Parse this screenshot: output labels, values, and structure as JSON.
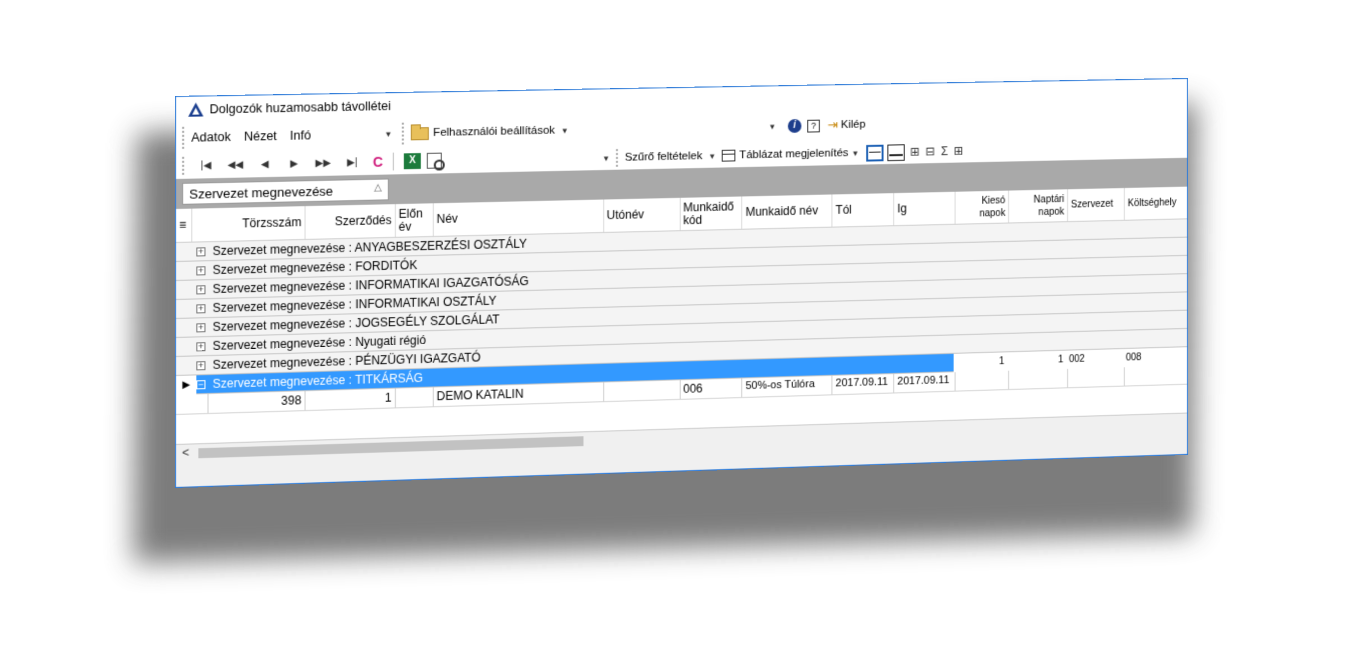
{
  "window": {
    "title": "Dolgozók huzamosabb távollétei",
    "btn_minimize": "—",
    "btn_maximize": "☐",
    "btn_close": "✕"
  },
  "menu": {
    "items": [
      "Adatok",
      "Nézet",
      "Infó"
    ],
    "user_settings": "Felhasználói beállítások",
    "info_glyph": "i",
    "help_glyph": "?",
    "exit": "Kilép"
  },
  "toolbar": {
    "nav": [
      "|◀",
      "◀◀",
      "◀",
      "▶",
      "▶▶",
      "▶|"
    ],
    "refresh": "C",
    "excel": "X",
    "filter": "Szűrő feltételek",
    "table_view": "Táblázat megjelenítés",
    "sum_glyph": "Σ"
  },
  "group_panel": {
    "chip": "Szervezet megnevezése"
  },
  "grid": {
    "columns": [
      "Törzsszám",
      "Szerződés",
      "Előn év",
      "Név",
      "Utónév",
      "Munkaidő kód",
      "Munkaidő név",
      "Tól",
      "Ig",
      "Kiesó napok",
      "Naptári napok",
      "Szervezet",
      "Költséghely"
    ],
    "groups": [
      "Szervezet megnevezése : ANYAGBESZERZÉSI OSZTÁLY",
      "Szervezet megnevezése : FORDITÓK",
      "Szervezet megnevezése : INFORMATIKAI IGAZGATÓSÁG",
      "Szervezet megnevezése : INFORMATIKAI OSZTÁLY",
      "Szervezet megnevezése : JOGSEGÉLY SZOLGÁLAT",
      "Szervezet megnevezése : Nyugati régió",
      "Szervezet megnevezése : PÉNZÜGYI IGAZGATÓ"
    ],
    "selected_group": "Szervezet megnevezése : TITKÁRSÁG",
    "selected_aggregates": {
      "kieso": "1",
      "naptari": "1",
      "szervezet": "002",
      "koltseghely": "008"
    },
    "row": {
      "torzsszam": "398",
      "szerzodes": "1",
      "elon": "",
      "nev": "DEMO KATALIN",
      "utonev": "",
      "mk_kod": "006",
      "mk_nev": "50%-os Túlóra",
      "tol": "2017.09.11",
      "ig": "2017.09.11"
    }
  }
}
